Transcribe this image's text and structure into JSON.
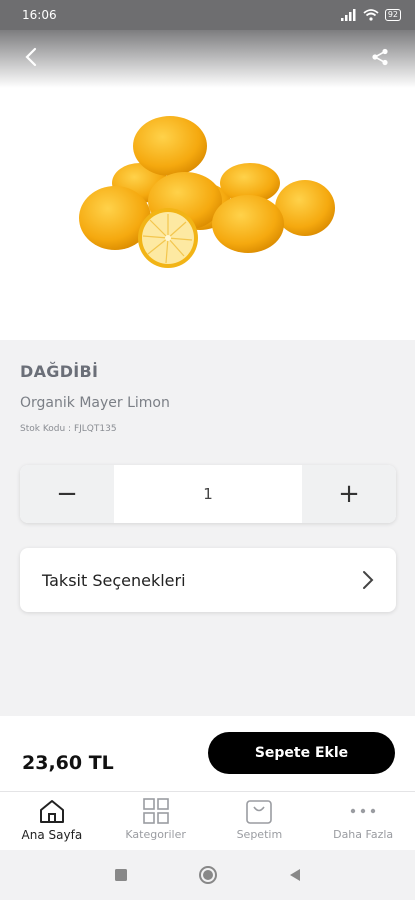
{
  "status_bar": {
    "time": "16:06",
    "battery": "92"
  },
  "header": {
    "back_icon": "chevron-left-icon",
    "share_icon": "share-icon"
  },
  "product": {
    "brand": "DAĞDİBİ",
    "name": "Organik Mayer Limon",
    "stock_code": "Stok Kodu : FJLQT135",
    "image": "lemons-photo"
  },
  "quantity": {
    "minus": "−",
    "value": "1",
    "plus": "+"
  },
  "installments": {
    "label": "Taksit Seçenekleri"
  },
  "purchase": {
    "price": "23,60 TL",
    "add_to_cart": "Sepete Ekle"
  },
  "tabs": [
    {
      "label": "Ana Sayfa",
      "icon": "home-icon",
      "active": true
    },
    {
      "label": "Kategoriler",
      "icon": "grid-icon",
      "active": false
    },
    {
      "label": "Sepetim",
      "icon": "bag-icon",
      "active": false
    },
    {
      "label": "Daha Fazla",
      "icon": "more-icon",
      "active": false
    }
  ],
  "colors": {
    "accent": "#000000",
    "background": "#f2f2f3"
  }
}
